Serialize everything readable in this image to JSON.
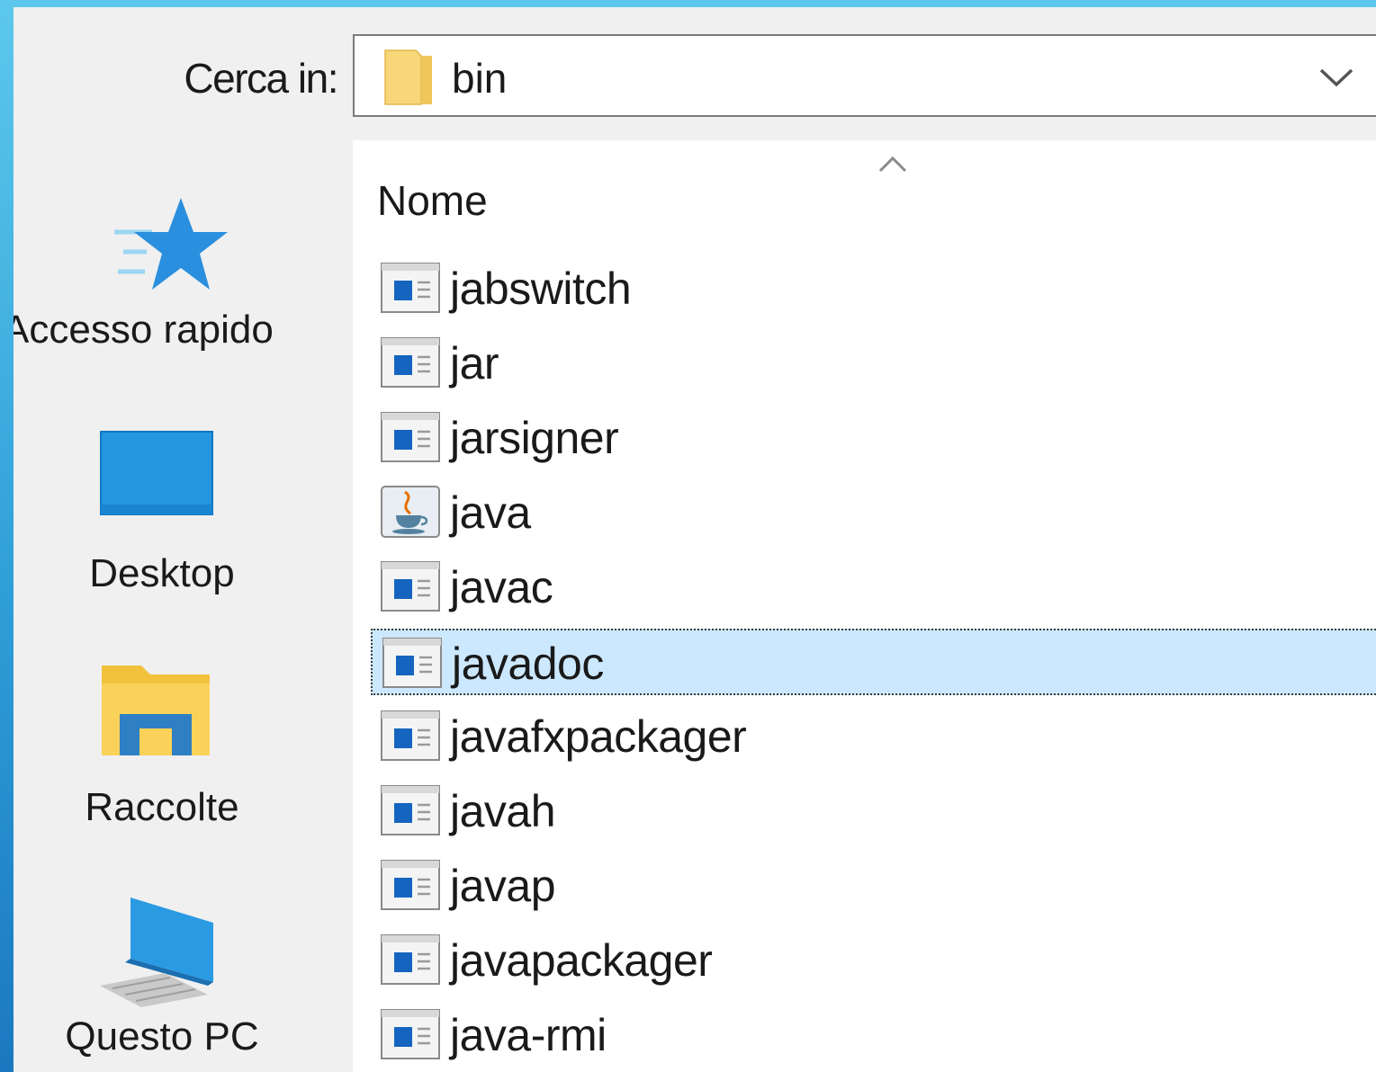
{
  "look_in": {
    "label": "Cerca in:",
    "value": "bin"
  },
  "places": [
    {
      "label": "Accesso rapido",
      "icon": "quick-access-star-icon"
    },
    {
      "label": "Desktop",
      "icon": "desktop-icon"
    },
    {
      "label": "Raccolte",
      "icon": "libraries-icon"
    },
    {
      "label": "Questo PC",
      "icon": "computer-icon"
    }
  ],
  "file_list": {
    "column_name": "Nome",
    "sort": "ascending",
    "selected": "javadoc",
    "files": [
      {
        "name": "jabswitch",
        "icon": "executable-icon"
      },
      {
        "name": "jar",
        "icon": "executable-icon"
      },
      {
        "name": "jarsigner",
        "icon": "executable-icon"
      },
      {
        "name": "java",
        "icon": "java-icon"
      },
      {
        "name": "javac",
        "icon": "executable-icon"
      },
      {
        "name": "javadoc",
        "icon": "executable-icon"
      },
      {
        "name": "javafxpackager",
        "icon": "executable-icon"
      },
      {
        "name": "javah",
        "icon": "executable-icon"
      },
      {
        "name": "javap",
        "icon": "executable-icon"
      },
      {
        "name": "javapackager",
        "icon": "executable-icon"
      },
      {
        "name": "java-rmi",
        "icon": "executable-icon"
      }
    ]
  },
  "colors": {
    "background_top": "#5dc8ec",
    "background_bottom": "#1b78c0",
    "dialog": "#f0f0f0",
    "selection": "#cce8ff"
  }
}
